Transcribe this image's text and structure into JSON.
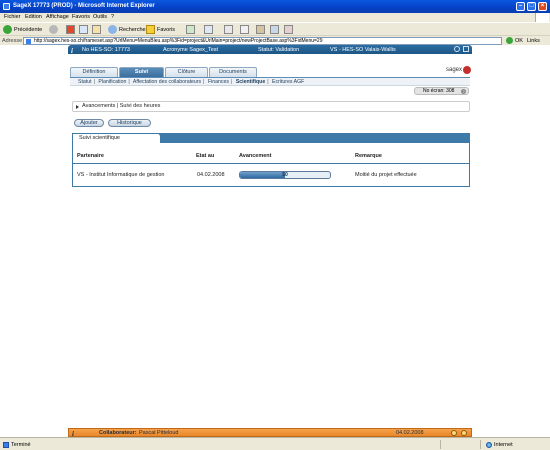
{
  "window": {
    "title": "SageX 17773 (PROD) - Microsoft Internet Explorer"
  },
  "menubar": {
    "items": [
      "Fichier",
      "Edition",
      "Affichage",
      "Favoris",
      "Outils",
      "?"
    ]
  },
  "toolbar": {
    "back_label": "Précédente",
    "search_label": "Rechercher",
    "favorites_label": "Favoris"
  },
  "addressbar": {
    "label": "Adresse",
    "url": "http://sagex.hes-so.ch/frameset.asp?UrlMenu=MenuBleu.asp%3Fid=project&UrlMain=project/newProjectBase.asp%3FidMenu=29",
    "go_label": "OK",
    "links_label": "Links"
  },
  "header": {
    "project_no": "No HES-SO: 17773",
    "acronym": "Acronyme Sagex_Test",
    "status": "Statut: Validation",
    "school": "VS - HES-SO Valais-Wallis"
  },
  "tabs": [
    {
      "label": "Définition"
    },
    {
      "label": "Suivi"
    },
    {
      "label": "Clôture"
    },
    {
      "label": "Documents"
    }
  ],
  "logo": {
    "text": "sagex"
  },
  "subnav": {
    "items": [
      "Statut",
      "Planification",
      "Affectation des collaborateurs",
      "Finances",
      "Scientifique",
      "Ecritures AGF"
    ]
  },
  "screen_no": "No écran: 308",
  "breadcrumb": {
    "item1": "Avancements",
    "separator": "|",
    "item2": "Suivi des heures"
  },
  "buttons": {
    "add": "Ajouter",
    "history": "Historique"
  },
  "panel": {
    "title": "Suivi scientifique",
    "columns": [
      "Partenaire",
      "Etat au",
      "Avancement",
      "Remarque"
    ],
    "rows": [
      {
        "partner": "VS - Institut Informatique de gestion",
        "date": "04.02.2008",
        "progress": 50,
        "progress_label": "50",
        "remark": "Moitié du projet effectuée"
      }
    ]
  },
  "footer": {
    "label": "Collaborateur:",
    "name": "Pascal Pitteloud",
    "date": "04.02.2008"
  },
  "statusbar": {
    "text": "Terminé",
    "zone": "Internet"
  },
  "colors": {
    "header_blue": "#1c5685",
    "panel_blue": "#3e7aa8",
    "footer_orange": "#e8872b",
    "progress_fill": "#2f6aa1"
  }
}
